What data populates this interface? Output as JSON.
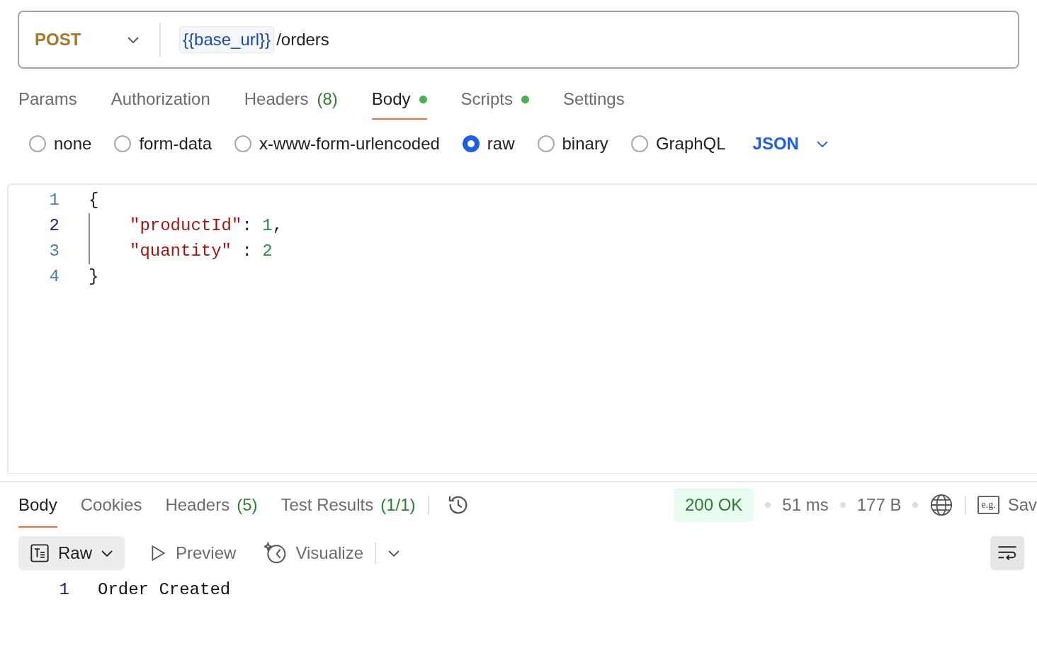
{
  "request": {
    "method": "POST",
    "url_variable": "{{base_url}}",
    "url_path": "/orders"
  },
  "request_tabs": [
    {
      "label": "Params",
      "selected": false
    },
    {
      "label": "Authorization",
      "selected": false
    },
    {
      "label": "Headers",
      "count": "(8)",
      "selected": false
    },
    {
      "label": "Body",
      "dot": true,
      "selected": true
    },
    {
      "label": "Scripts",
      "dot": true,
      "selected": false
    },
    {
      "label": "Settings",
      "selected": false
    }
  ],
  "body_types": [
    {
      "label": "none",
      "selected": false
    },
    {
      "label": "form-data",
      "selected": false
    },
    {
      "label": "x-www-form-urlencoded",
      "selected": false
    },
    {
      "label": "raw",
      "selected": true
    },
    {
      "label": "binary",
      "selected": false
    },
    {
      "label": "GraphQL",
      "selected": false
    }
  ],
  "body_format": "JSON",
  "editor_lines": [
    {
      "number": "1",
      "active": false,
      "indent_guide": false,
      "tokens": [
        {
          "kind": "punct",
          "text": "{"
        }
      ]
    },
    {
      "number": "2",
      "active": true,
      "indent_guide": true,
      "tokens": [
        {
          "kind": "key",
          "text": "\"productId\""
        },
        {
          "kind": "punct",
          "text": ": "
        },
        {
          "kind": "number",
          "text": "1"
        },
        {
          "kind": "punct",
          "text": ","
        }
      ]
    },
    {
      "number": "3",
      "active": false,
      "indent_guide": true,
      "tokens": [
        {
          "kind": "key",
          "text": "\"quantity\""
        },
        {
          "kind": "punct",
          "text": " : "
        },
        {
          "kind": "number",
          "text": "2"
        }
      ]
    },
    {
      "number": "4",
      "active": false,
      "indent_guide": false,
      "tokens": [
        {
          "kind": "punct",
          "text": "}"
        }
      ]
    }
  ],
  "response_tabs": [
    {
      "label": "Body",
      "selected": true
    },
    {
      "label": "Cookies",
      "selected": false
    },
    {
      "label": "Headers",
      "count": "(5)",
      "selected": false
    },
    {
      "label": "Test Results",
      "count": "(1/1)",
      "selected": false
    }
  ],
  "response_status": {
    "status": "200 OK",
    "time": "51 ms",
    "size": "177 B",
    "example_icon_text": "e.g.",
    "save_label": "Sav"
  },
  "response_toolbar": {
    "format": "Raw",
    "preview": "Preview",
    "visualize": "Visualize",
    "wrap_on": true
  },
  "response_lines": [
    {
      "number": "1",
      "text": "Order Created"
    }
  ]
}
